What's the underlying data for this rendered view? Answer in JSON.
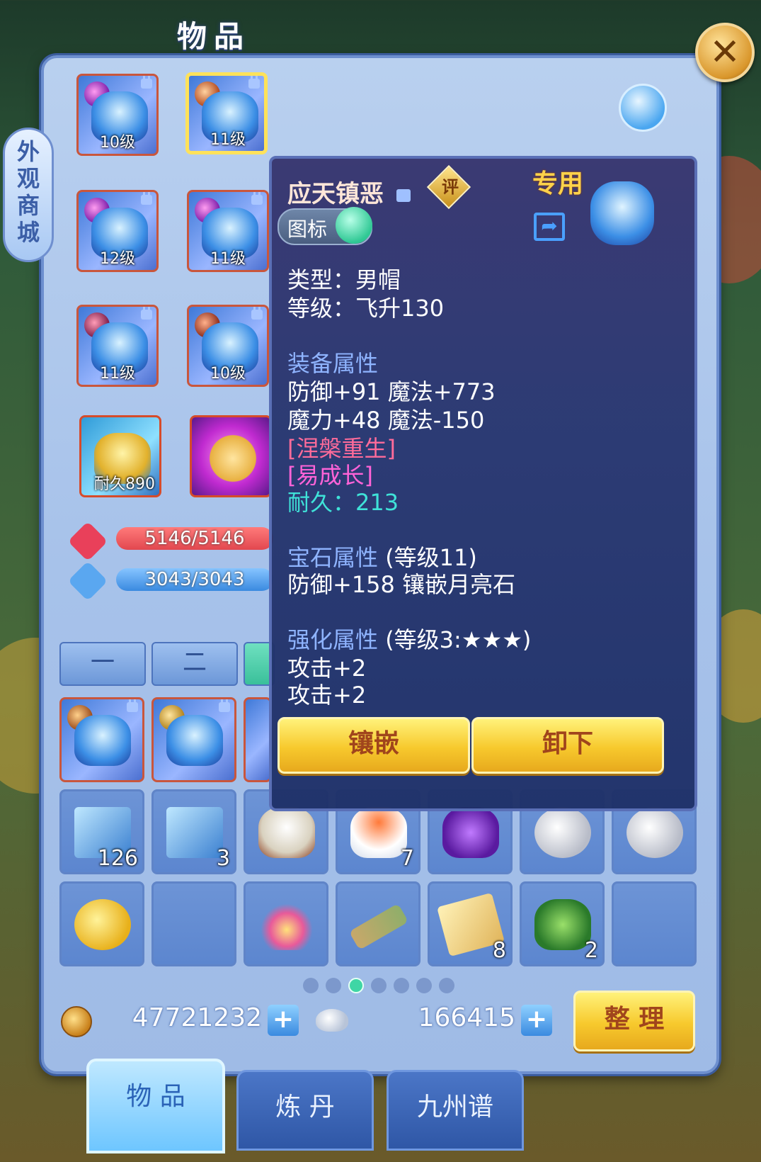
{
  "window": {
    "title": "物品",
    "close_icon": "close-icon"
  },
  "side_shop": {
    "chars": [
      "外",
      "观",
      "商",
      "城"
    ]
  },
  "equipment": [
    {
      "level": "10级",
      "locked": true
    },
    {
      "level": "11级",
      "locked": true,
      "selected": true
    },
    {
      "level": "12级",
      "locked": true
    },
    {
      "level": "11级",
      "locked": true
    },
    {
      "level": "11级",
      "locked": true
    },
    {
      "level": "10级",
      "locked": true
    },
    {
      "level": "耐久890",
      "locked": false
    },
    {
      "level": "",
      "locked": false
    }
  ],
  "stats": {
    "hp": "5146/5146",
    "mp": "3043/3043"
  },
  "bag_tabs": [
    "一",
    "二"
  ],
  "tooltip": {
    "name": "应天镇恶",
    "rate_label": "评",
    "exclusive": "专用",
    "icon_toggle": "图标",
    "type_line": "类型：男帽",
    "level_line": "等级：飞升130",
    "equip_header": "装备属性",
    "equip_attrs": [
      "防御+91 魔法+773",
      "魔力+48 魔法-150"
    ],
    "special_1": "[涅槃重生]",
    "special_2": "[易成长]",
    "durability": "耐久：213",
    "gem_header": "宝石属性",
    "gem_level": "(等级11)",
    "gem_attr": "防御+158 镶嵌月亮石",
    "enhance_header": "强化属性",
    "enhance_level": "(等级3:★★★)",
    "enhance_attrs": [
      "攻击+2",
      "攻击+2"
    ],
    "inlay_button": "镶嵌",
    "unequip_button": "卸下"
  },
  "inventory_row1": [
    {
      "count": "126"
    },
    {
      "count": "3"
    },
    {
      "count": ""
    },
    {
      "count": "7"
    },
    {
      "count": ""
    },
    {
      "count": ""
    },
    {
      "count": ""
    }
  ],
  "inventory_row2": [
    {
      "count": ""
    },
    {
      "count": ""
    },
    {
      "count": ""
    },
    {
      "count": ""
    },
    {
      "count": "8"
    },
    {
      "count": "2"
    },
    {
      "count": ""
    }
  ],
  "pagination": {
    "pages": 7,
    "current": 3
  },
  "currency": {
    "coins": "47721232",
    "silver": "166415",
    "sort_button": "整 理"
  },
  "bottom_tabs": [
    "物 品",
    "炼 丹",
    "九州谱"
  ]
}
